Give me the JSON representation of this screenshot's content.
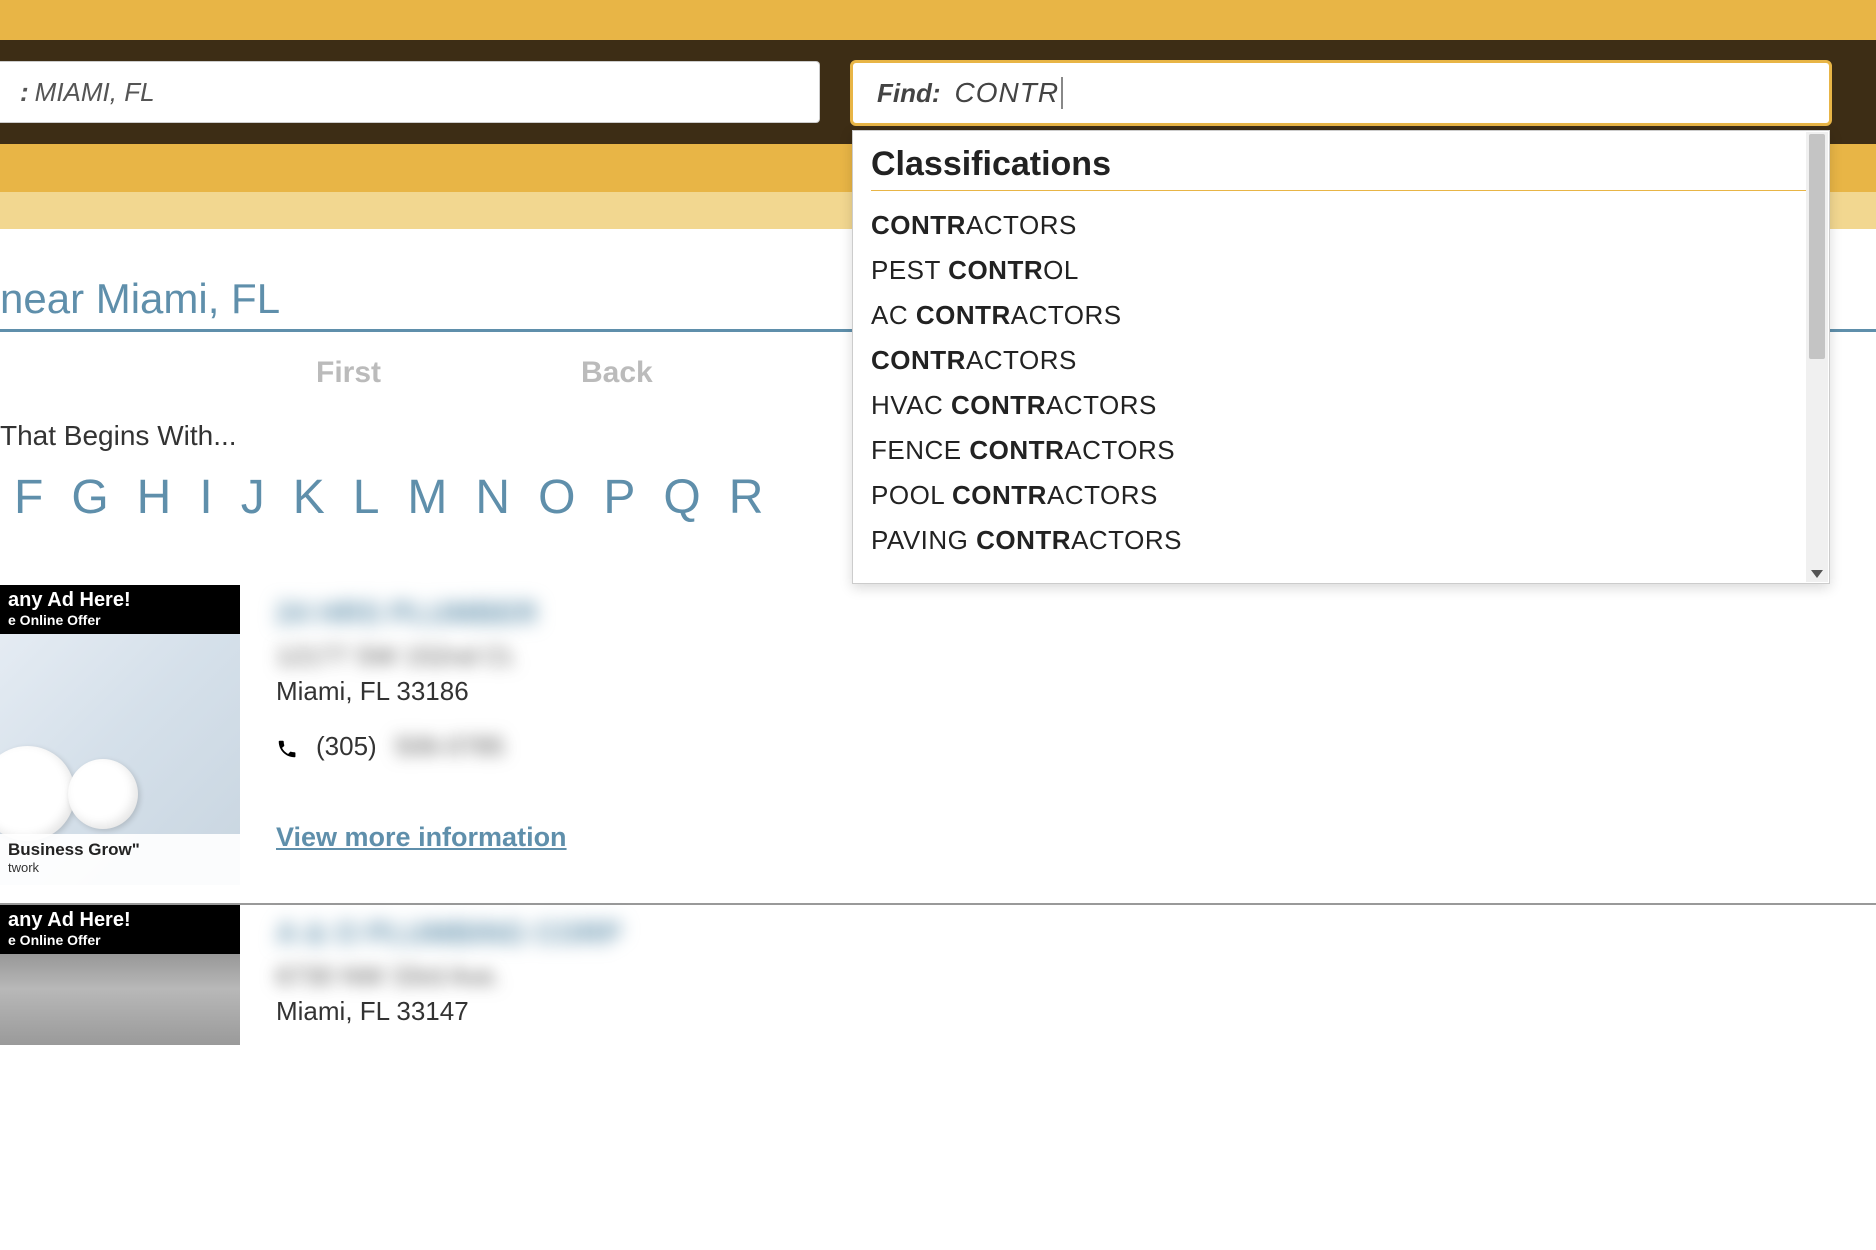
{
  "search": {
    "location_value": "MIAMI, FL",
    "find_label": "Find:",
    "find_value": "CONTR"
  },
  "dropdown": {
    "heading": "Classifications",
    "items": [
      {
        "prefix": "",
        "match": "CONTR",
        "suffix": "ACTORS"
      },
      {
        "prefix": "PEST ",
        "match": "CONTR",
        "suffix": "OL"
      },
      {
        "prefix": "AC ",
        "match": "CONTR",
        "suffix": "ACTORS"
      },
      {
        "prefix": "",
        "match": "CONTR",
        "suffix": "ACTORS"
      },
      {
        "prefix": "HVAC ",
        "match": "CONTR",
        "suffix": "ACTORS"
      },
      {
        "prefix": "FENCE ",
        "match": "CONTR",
        "suffix": "ACTORS"
      },
      {
        "prefix": "POOL ",
        "match": "CONTR",
        "suffix": "ACTORS"
      },
      {
        "prefix": "PAVING ",
        "match": "CONTR",
        "suffix": "ACTORS"
      }
    ]
  },
  "page": {
    "title_suffix": "near Miami, FL",
    "pager_first": "First",
    "pager_back": "Back",
    "begins_with": "That Begins With...",
    "alpha": [
      "F",
      "G",
      "H",
      "I",
      "J",
      "K",
      "L",
      "M",
      "N",
      "O",
      "P",
      "Q",
      "R"
    ]
  },
  "ad": {
    "header_line1": "any Ad Here!",
    "header_line2": "e Online Offer",
    "footer_line1": "Business Grow\"",
    "footer_line2": "twork"
  },
  "listings": [
    {
      "name": "24 HRS PLUMBER",
      "addr1": "12177 SW 152nd Ct.",
      "citystate": "Miami, FL 33186",
      "phone_prefix": "(305)",
      "phone_rest": "506-0785",
      "view_more": "View more information"
    },
    {
      "name": "A & O PLUMBING CORP",
      "addr1": "6730 NW 33rd Ave.",
      "citystate": "Miami, FL 33147"
    }
  ]
}
